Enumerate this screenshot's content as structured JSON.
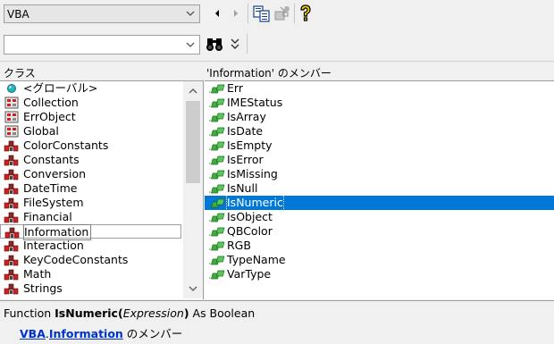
{
  "toolbar": {
    "library_value": "VBA",
    "search_value": "",
    "search_placeholder": ""
  },
  "panes": {
    "classes_title": "クラス",
    "members_title": "'Information' のメンバー"
  },
  "classes": [
    {
      "label": "<グローバル>",
      "icon": "globals-icon"
    },
    {
      "label": "Collection",
      "icon": "class-icon"
    },
    {
      "label": "ErrObject",
      "icon": "class-icon"
    },
    {
      "label": "Global",
      "icon": "class-icon"
    },
    {
      "label": "ColorConstants",
      "icon": "module-icon"
    },
    {
      "label": "Constants",
      "icon": "module-icon"
    },
    {
      "label": "Conversion",
      "icon": "module-icon"
    },
    {
      "label": "DateTime",
      "icon": "module-icon"
    },
    {
      "label": "FileSystem",
      "icon": "module-icon"
    },
    {
      "label": "Financial",
      "icon": "module-icon"
    },
    {
      "label": "Information",
      "icon": "module-icon",
      "selected": true
    },
    {
      "label": "Interaction",
      "icon": "module-icon"
    },
    {
      "label": "KeyCodeConstants",
      "icon": "module-icon"
    },
    {
      "label": "Math",
      "icon": "module-icon"
    },
    {
      "label": "Strings",
      "icon": "module-icon"
    }
  ],
  "members": [
    {
      "label": "Err",
      "icon": "method-icon"
    },
    {
      "label": "IMEStatus",
      "icon": "method-icon"
    },
    {
      "label": "IsArray",
      "icon": "method-icon"
    },
    {
      "label": "IsDate",
      "icon": "method-icon"
    },
    {
      "label": "IsEmpty",
      "icon": "method-icon"
    },
    {
      "label": "IsError",
      "icon": "method-icon"
    },
    {
      "label": "IsMissing",
      "icon": "method-icon"
    },
    {
      "label": "IsNull",
      "icon": "method-icon"
    },
    {
      "label": "IsNumeric",
      "icon": "method-icon",
      "selected": true
    },
    {
      "label": "IsObject",
      "icon": "method-icon"
    },
    {
      "label": "QBColor",
      "icon": "method-icon"
    },
    {
      "label": "RGB",
      "icon": "method-icon"
    },
    {
      "label": "TypeName",
      "icon": "method-icon"
    },
    {
      "label": "VarType",
      "icon": "method-icon"
    }
  ],
  "details": {
    "prefix": "Function ",
    "name": "IsNumeric(",
    "param": "Expression",
    "close": ")",
    "suffix": " As Boolean",
    "library_link": "VBA",
    "dot": ".",
    "class_link": "Information",
    "member_of": " のメンバー"
  },
  "colors": {
    "selection": "#0078d7",
    "link": "#0033cc"
  }
}
